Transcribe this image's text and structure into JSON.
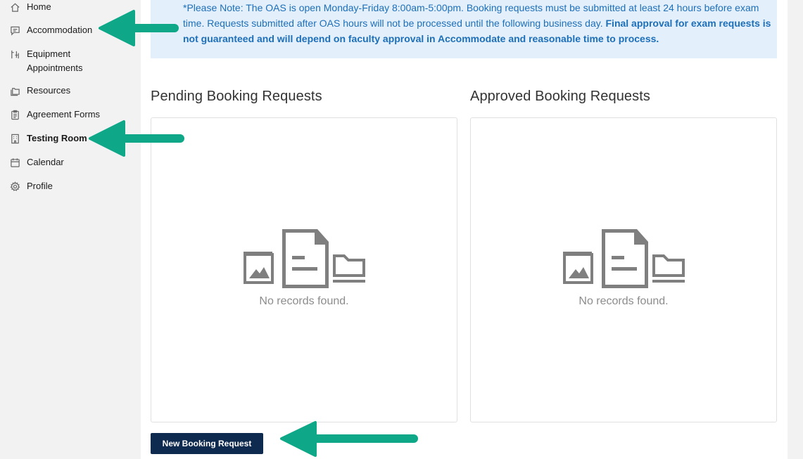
{
  "sidebar": {
    "items": [
      {
        "label": "Home",
        "icon": "home-icon"
      },
      {
        "label": "Accommodation",
        "icon": "chat-icon"
      },
      {
        "label": "Equipment Appointments",
        "icon": "equipment-icon"
      },
      {
        "label": "Resources",
        "icon": "folders-icon"
      },
      {
        "label": "Agreement Forms",
        "icon": "clipboard-icon"
      },
      {
        "label": "Testing Room",
        "icon": "building-icon"
      },
      {
        "label": "Calendar",
        "icon": "calendar-icon"
      },
      {
        "label": "Profile",
        "icon": "gear-icon"
      }
    ]
  },
  "notice": {
    "text": "*Please Note: The OAS is open Monday-Friday 8:00am-5:00pm. Booking requests must be submitted at least 24 hours before exam time. Requests submitted after OAS hours will not be processed until the following business day. ",
    "bold_text": "Final approval for exam requests is not guaranteed and will depend on faculty approval in Accommodate and reasonable time to process."
  },
  "pending": {
    "title": "Pending Booking Requests",
    "empty_text": "No records found."
  },
  "approved": {
    "title": "Approved Booking Requests",
    "empty_text": "No records found."
  },
  "actions": {
    "new_booking_label": "New Booking Request"
  },
  "colors": {
    "notice_bg": "#e3effb",
    "notice_text": "#1d6fb8",
    "button_bg": "#0f2a4f",
    "annotation_arrow": "#0ea889"
  }
}
